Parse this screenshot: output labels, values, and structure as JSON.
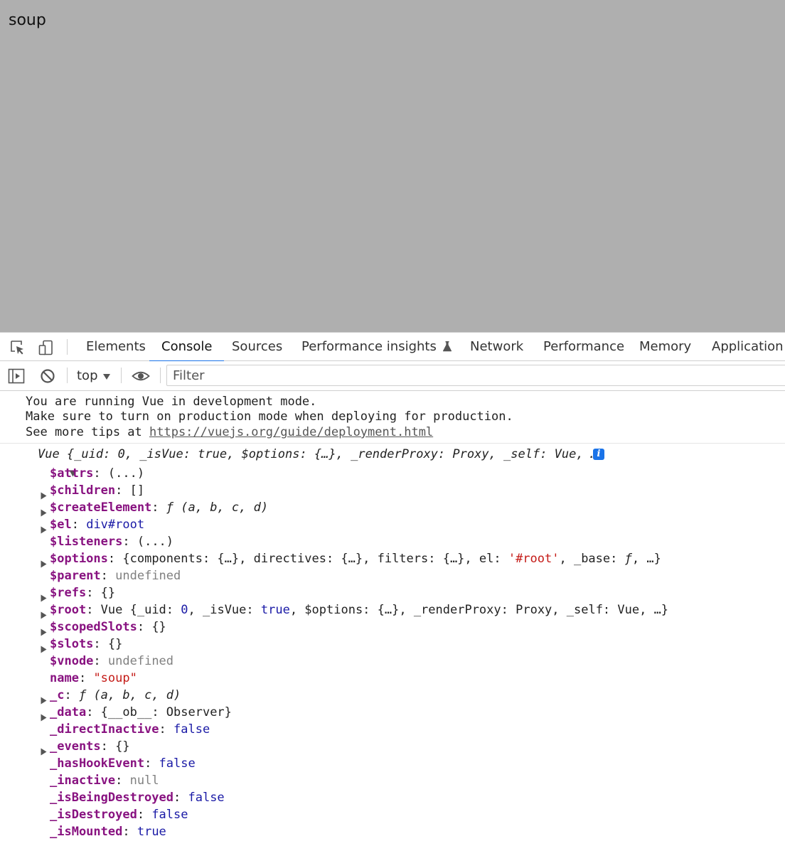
{
  "page": {
    "text": "soup"
  },
  "devtools": {
    "tabs": [
      {
        "label": "Elements"
      },
      {
        "label": "Console",
        "active": true
      },
      {
        "label": "Sources"
      },
      {
        "label": "Performance insights",
        "icon": "flask-icon"
      },
      {
        "label": "Network"
      },
      {
        "label": "Performance"
      },
      {
        "label": "Memory"
      },
      {
        "label": "Application"
      }
    ],
    "toolbar": {
      "context": "top",
      "filter_placeholder": "Filter"
    },
    "accent": "#1a73e8"
  },
  "console": {
    "message": {
      "line1": "You are running Vue in development mode.",
      "line2": "Make sure to turn on production mode when deploying for production.",
      "line3_prefix": "See more tips at ",
      "link": "https://vuejs.org/guide/deployment.html"
    },
    "object_header": "Vue {_uid: 0, _isVue: true, $options: {…}, _renderProxy: Proxy, _self: Vue, …}",
    "rows": [
      {
        "key": "$attrs",
        "expandable": false,
        "value": [
          {
            "t": "(...)",
            "c": "plain"
          }
        ]
      },
      {
        "key": "$children",
        "expandable": true,
        "value": [
          {
            "t": "[]",
            "c": "plain"
          }
        ]
      },
      {
        "key": "$createElement",
        "expandable": true,
        "value": [
          {
            "t": "ƒ (a, b, c, d)",
            "c": "it"
          }
        ]
      },
      {
        "key": "$el",
        "expandable": true,
        "value": [
          {
            "t": "div#root",
            "c": "kw"
          }
        ]
      },
      {
        "key": "$listeners",
        "expandable": false,
        "value": [
          {
            "t": "(...)",
            "c": "plain"
          }
        ]
      },
      {
        "key": "$options",
        "expandable": true,
        "value": [
          {
            "t": "{components: {…}, directives: {…}, filters: {…}, el: ",
            "c": "plain"
          },
          {
            "t": "'#root'",
            "c": "str"
          },
          {
            "t": ", _base: ",
            "c": "plain"
          },
          {
            "t": "ƒ",
            "c": "it"
          },
          {
            "t": ", …}",
            "c": "plain"
          }
        ]
      },
      {
        "key": "$parent",
        "expandable": false,
        "value": [
          {
            "t": "undefined",
            "c": "null"
          }
        ]
      },
      {
        "key": "$refs",
        "expandable": true,
        "value": [
          {
            "t": "{}",
            "c": "plain"
          }
        ]
      },
      {
        "key": "$root",
        "expandable": true,
        "value": [
          {
            "t": "Vue {_uid: ",
            "c": "plain"
          },
          {
            "t": "0",
            "c": "num"
          },
          {
            "t": ", _isVue: ",
            "c": "plain"
          },
          {
            "t": "true",
            "c": "kw"
          },
          {
            "t": ", $options: {…}, _renderProxy: Proxy, _self: Vue, …}",
            "c": "plain"
          }
        ]
      },
      {
        "key": "$scopedSlots",
        "expandable": true,
        "value": [
          {
            "t": "{}",
            "c": "plain"
          }
        ]
      },
      {
        "key": "$slots",
        "expandable": true,
        "value": [
          {
            "t": "{}",
            "c": "plain"
          }
        ]
      },
      {
        "key": "$vnode",
        "expandable": false,
        "value": [
          {
            "t": "undefined",
            "c": "null"
          }
        ]
      },
      {
        "key": "name",
        "expandable": false,
        "value": [
          {
            "t": "\"soup\"",
            "c": "str"
          }
        ]
      },
      {
        "key": "_c",
        "expandable": true,
        "value": [
          {
            "t": "ƒ (a, b, c, d)",
            "c": "it"
          }
        ]
      },
      {
        "key": "_data",
        "expandable": true,
        "value": [
          {
            "t": "{__ob__: Observer}",
            "c": "plain"
          }
        ]
      },
      {
        "key": "_directInactive",
        "expandable": false,
        "value": [
          {
            "t": "false",
            "c": "kw"
          }
        ]
      },
      {
        "key": "_events",
        "expandable": true,
        "value": [
          {
            "t": "{}",
            "c": "plain"
          }
        ]
      },
      {
        "key": "_hasHookEvent",
        "expandable": false,
        "value": [
          {
            "t": "false",
            "c": "kw"
          }
        ]
      },
      {
        "key": "_inactive",
        "expandable": false,
        "value": [
          {
            "t": "null",
            "c": "null"
          }
        ]
      },
      {
        "key": "_isBeingDestroyed",
        "expandable": false,
        "value": [
          {
            "t": "false",
            "c": "kw"
          }
        ]
      },
      {
        "key": "_isDestroyed",
        "expandable": false,
        "value": [
          {
            "t": "false",
            "c": "kw"
          }
        ]
      },
      {
        "key": "_isMounted",
        "expandable": false,
        "value": [
          {
            "t": "true",
            "c": "kw"
          }
        ]
      }
    ]
  }
}
